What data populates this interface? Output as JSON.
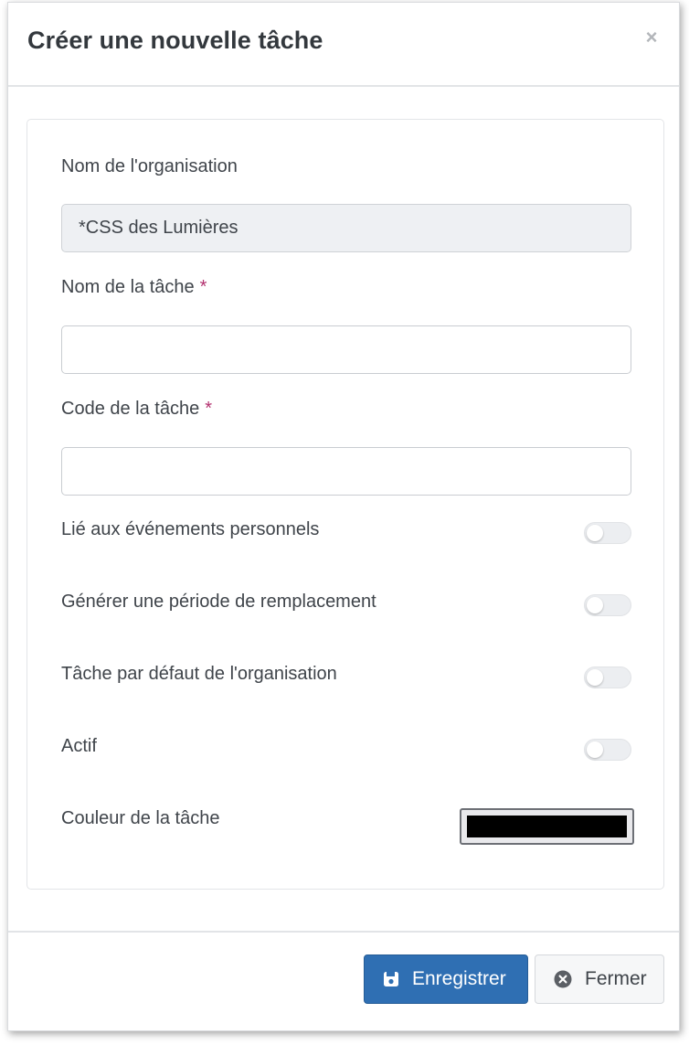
{
  "dialog": {
    "title": "Créer une nouvelle tâche",
    "close_glyph": "×"
  },
  "form": {
    "org_name": {
      "label": "Nom de l'organisation",
      "value": "*CSS des Lumières"
    },
    "task_name": {
      "label": "Nom de la tâche",
      "required_mark": "*",
      "value": ""
    },
    "task_code": {
      "label": "Code de la tâche",
      "required_mark": "*",
      "value": ""
    },
    "toggles": [
      {
        "label": "Lié aux événements personnels",
        "checked": false
      },
      {
        "label": "Générer une période de remplacement",
        "checked": false
      },
      {
        "label": "Tâche par défaut de l'organisation",
        "checked": false
      },
      {
        "label": "Actif",
        "checked": false
      }
    ],
    "color": {
      "label": "Couleur de la tâche",
      "value": "#000000"
    }
  },
  "footer": {
    "save_label": "Enregistrer",
    "save_icon": "floppy-disk-icon",
    "close_label": "Fermer",
    "close_icon": "circle-x-icon"
  },
  "colors": {
    "primary": "#2f6fb3",
    "required": "#b3316f"
  }
}
